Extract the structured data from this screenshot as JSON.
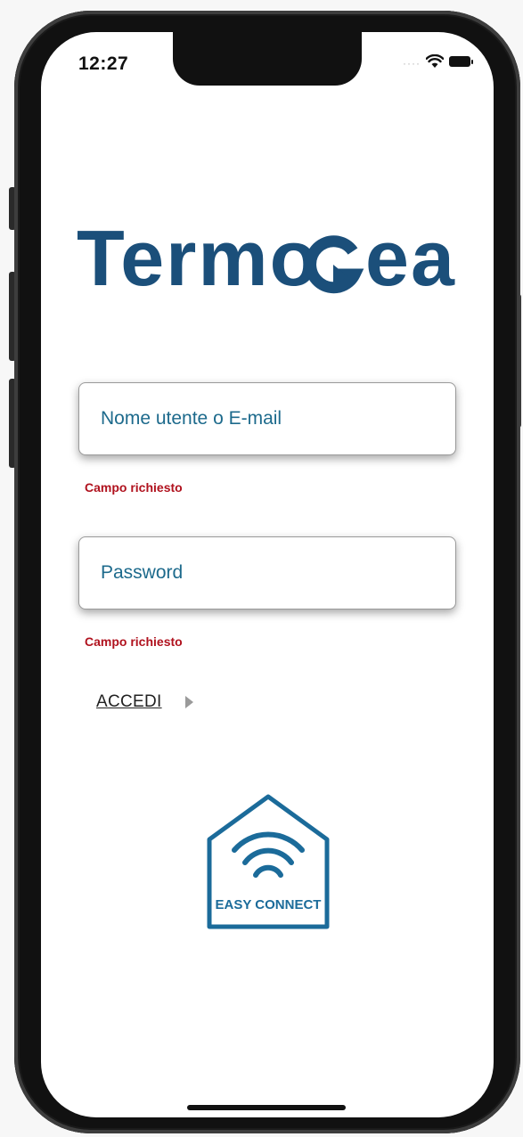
{
  "status_bar": {
    "time": "12:27",
    "signal_icon": "signal-dots-icon",
    "wifi_icon": "wifi-icon",
    "battery_icon": "battery-icon"
  },
  "brand": {
    "logo_text": "TermoGea",
    "color": "#1b4f7a"
  },
  "login_form": {
    "username": {
      "placeholder": "Nome utente o E-mail",
      "value": "",
      "error": "Campo richiesto"
    },
    "password": {
      "placeholder": "Password",
      "value": "",
      "error": "Campo richiesto"
    },
    "submit_label": "ACCEDI",
    "submit_icon": "chevron-right-icon"
  },
  "easy_connect": {
    "label": "EASY CONNECT",
    "icon": "house-wifi-icon",
    "color": "#1b6b9a"
  },
  "colors": {
    "field_text": "#1d6a8c",
    "error_text": "#b0121e"
  }
}
